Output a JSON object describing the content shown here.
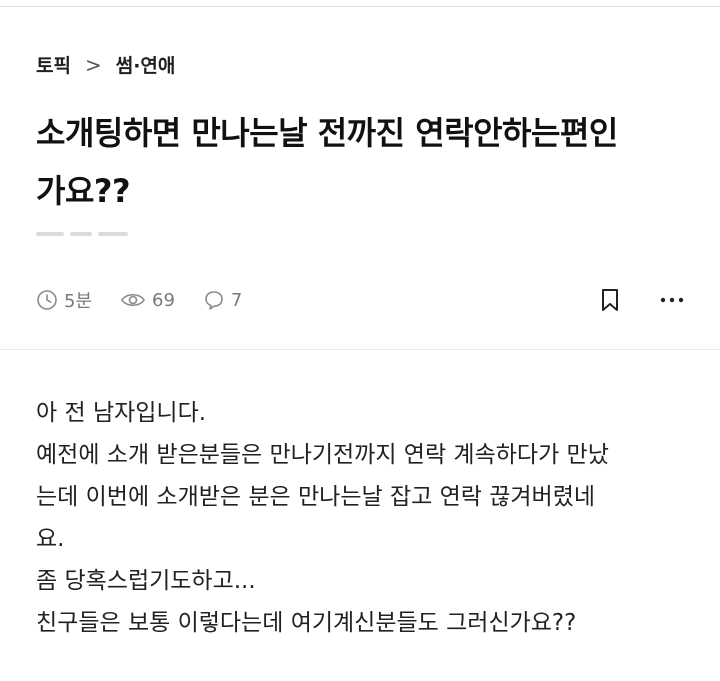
{
  "breadcrumb": {
    "category": "토픽",
    "separator": ">",
    "subcategory": "썸·연애"
  },
  "post": {
    "title": "소개팅하면 만나는날 전까진 연락안하는편인가요??",
    "title_lines": [
      "소개팅하면 만나는날 전까진 연락안하는편인",
      "가요??"
    ]
  },
  "meta": {
    "time": "5분",
    "views": "69",
    "comments": "7"
  },
  "icons": {
    "time": "clock-icon",
    "views": "eye-icon",
    "comments": "comment-icon",
    "bookmark": "bookmark-icon",
    "more": "more-dots-icon"
  },
  "body": {
    "lines": [
      "아 전 남자입니다.",
      "예전에 소개 받은분들은 만나기전까지 연락 계속하다가 만났",
      "는데 이번에 소개받은 분은 만나는날 잡고 연락 끊겨버렸네",
      "요.",
      "좀 당혹스럽기도하고...",
      "친구들은 보통 이렇다는데 여기계신분들도 그러신가요??"
    ]
  },
  "colors": {
    "text": "#1f1f1f",
    "meta": "#7a7a7a",
    "divider": "#ececec"
  }
}
